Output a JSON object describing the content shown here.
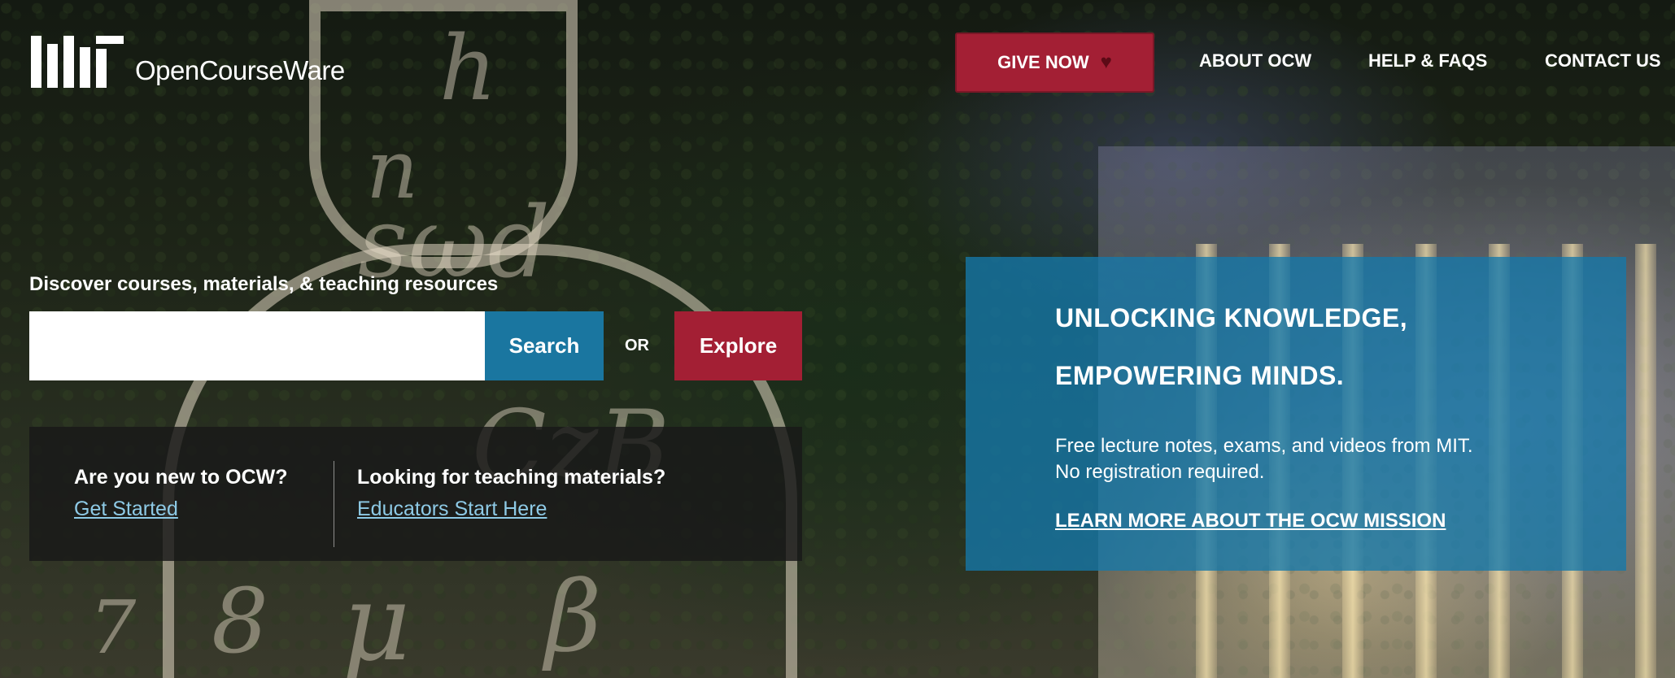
{
  "header": {
    "logo_text": "OpenCourseWare",
    "logo_icon": "mit-logo",
    "give_label": "GIVE NOW",
    "give_icon": "heart-icon",
    "nav": [
      "ABOUT OCW",
      "HELP & FAQS",
      "CONTACT US"
    ]
  },
  "search": {
    "prompt": "Discover courses, materials, & teaching resources",
    "input_value": "",
    "placeholder": "",
    "search_label": "Search",
    "or_label": "OR",
    "explore_label": "Explore"
  },
  "info": {
    "new_title": "Are you new to OCW?",
    "new_link": "Get Started",
    "edu_title": "Looking for teaching materials?",
    "edu_link": "Educators Start Here"
  },
  "mission": {
    "line1": "UNLOCKING KNOWLEDGE,",
    "line2": "EMPOWERING MINDS.",
    "desc1": "Free lecture notes, exams, and videos from MIT.",
    "desc2": "No registration required.",
    "link": "LEARN MORE ABOUT THE OCW MISSION"
  },
  "colors": {
    "mit_red": "#a31f34",
    "search_blue": "#1a76a0",
    "mission_panel": "#1478aa",
    "info_panel": "#191919",
    "link_blue": "#8ecae6"
  }
}
